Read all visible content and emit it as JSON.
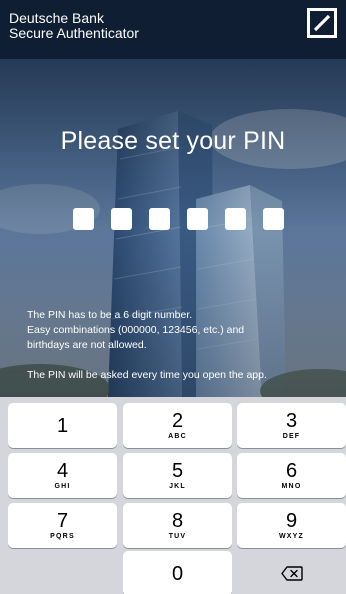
{
  "header": {
    "brand_line1": "Deutsche Bank",
    "brand_line2": "Secure Authenticator",
    "logo_icon": "deutsche-bank-logo"
  },
  "main": {
    "title": "Please set your PIN",
    "pin_length": 6,
    "info_line1": "The PIN has to be a 6 digit number.",
    "info_line2": "Easy combinations (000000, 123456, etc.) and",
    "info_line3": "birthdays are not allowed.",
    "info_line4": "The PIN will be asked every time you open the app."
  },
  "keypad": {
    "keys": [
      {
        "num": "1",
        "letters": ""
      },
      {
        "num": "2",
        "letters": "ABC"
      },
      {
        "num": "3",
        "letters": "DEF"
      },
      {
        "num": "4",
        "letters": "GHI"
      },
      {
        "num": "5",
        "letters": "JKL"
      },
      {
        "num": "6",
        "letters": "MNO"
      },
      {
        "num": "7",
        "letters": "PQRS"
      },
      {
        "num": "8",
        "letters": "TUV"
      },
      {
        "num": "9",
        "letters": "WXYZ"
      },
      {
        "num": "0",
        "letters": ""
      }
    ],
    "delete_icon": "backspace-icon"
  },
  "colors": {
    "header_bg": "#0f1e33",
    "keypad_bg": "#d4d6dc",
    "key_bg": "#ffffff"
  }
}
